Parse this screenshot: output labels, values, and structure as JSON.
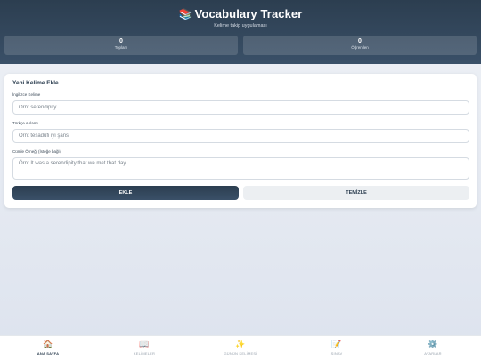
{
  "header": {
    "icon": "books-icon",
    "title": "Vocabulary Tracker",
    "subtitle": "Kelime takip uygulaması",
    "stats": [
      {
        "value": "0",
        "label": "Toplam"
      },
      {
        "value": "0",
        "label": "Öğrenilen"
      }
    ]
  },
  "form": {
    "title": "Yeni Kelime Ekle",
    "english": {
      "label": "İngilizce Kelime",
      "placeholder": "Örn: serendipity"
    },
    "turkish": {
      "label": "Türkçe Anlamı",
      "placeholder": "Örn: tesadüfi iyi şans"
    },
    "example": {
      "label": "Cümle Örneği (İsteğe bağlı)",
      "placeholder": "Örn: It was a serendipity that we met that day."
    },
    "add_label": "EKLE",
    "clear_label": "TEMİZLE"
  },
  "nav": {
    "items": [
      {
        "icon": "home-icon",
        "glyph": "🏠",
        "label": "ANA SAYFA",
        "active": true
      },
      {
        "icon": "book-icon",
        "glyph": "📖",
        "label": "KELİMELER"
      },
      {
        "icon": "sparkles-icon",
        "glyph": "✨",
        "label": "GÜNÜN KELİMESİ"
      },
      {
        "icon": "memo-icon",
        "glyph": "📝",
        "label": "SINAV"
      },
      {
        "icon": "gear-icon",
        "glyph": "⚙️",
        "label": "AYARLAR"
      }
    ]
  },
  "colors": {
    "header_bg": "#2c3e50",
    "accent": "#2c3e50",
    "secondary_button": "#eceff2"
  }
}
